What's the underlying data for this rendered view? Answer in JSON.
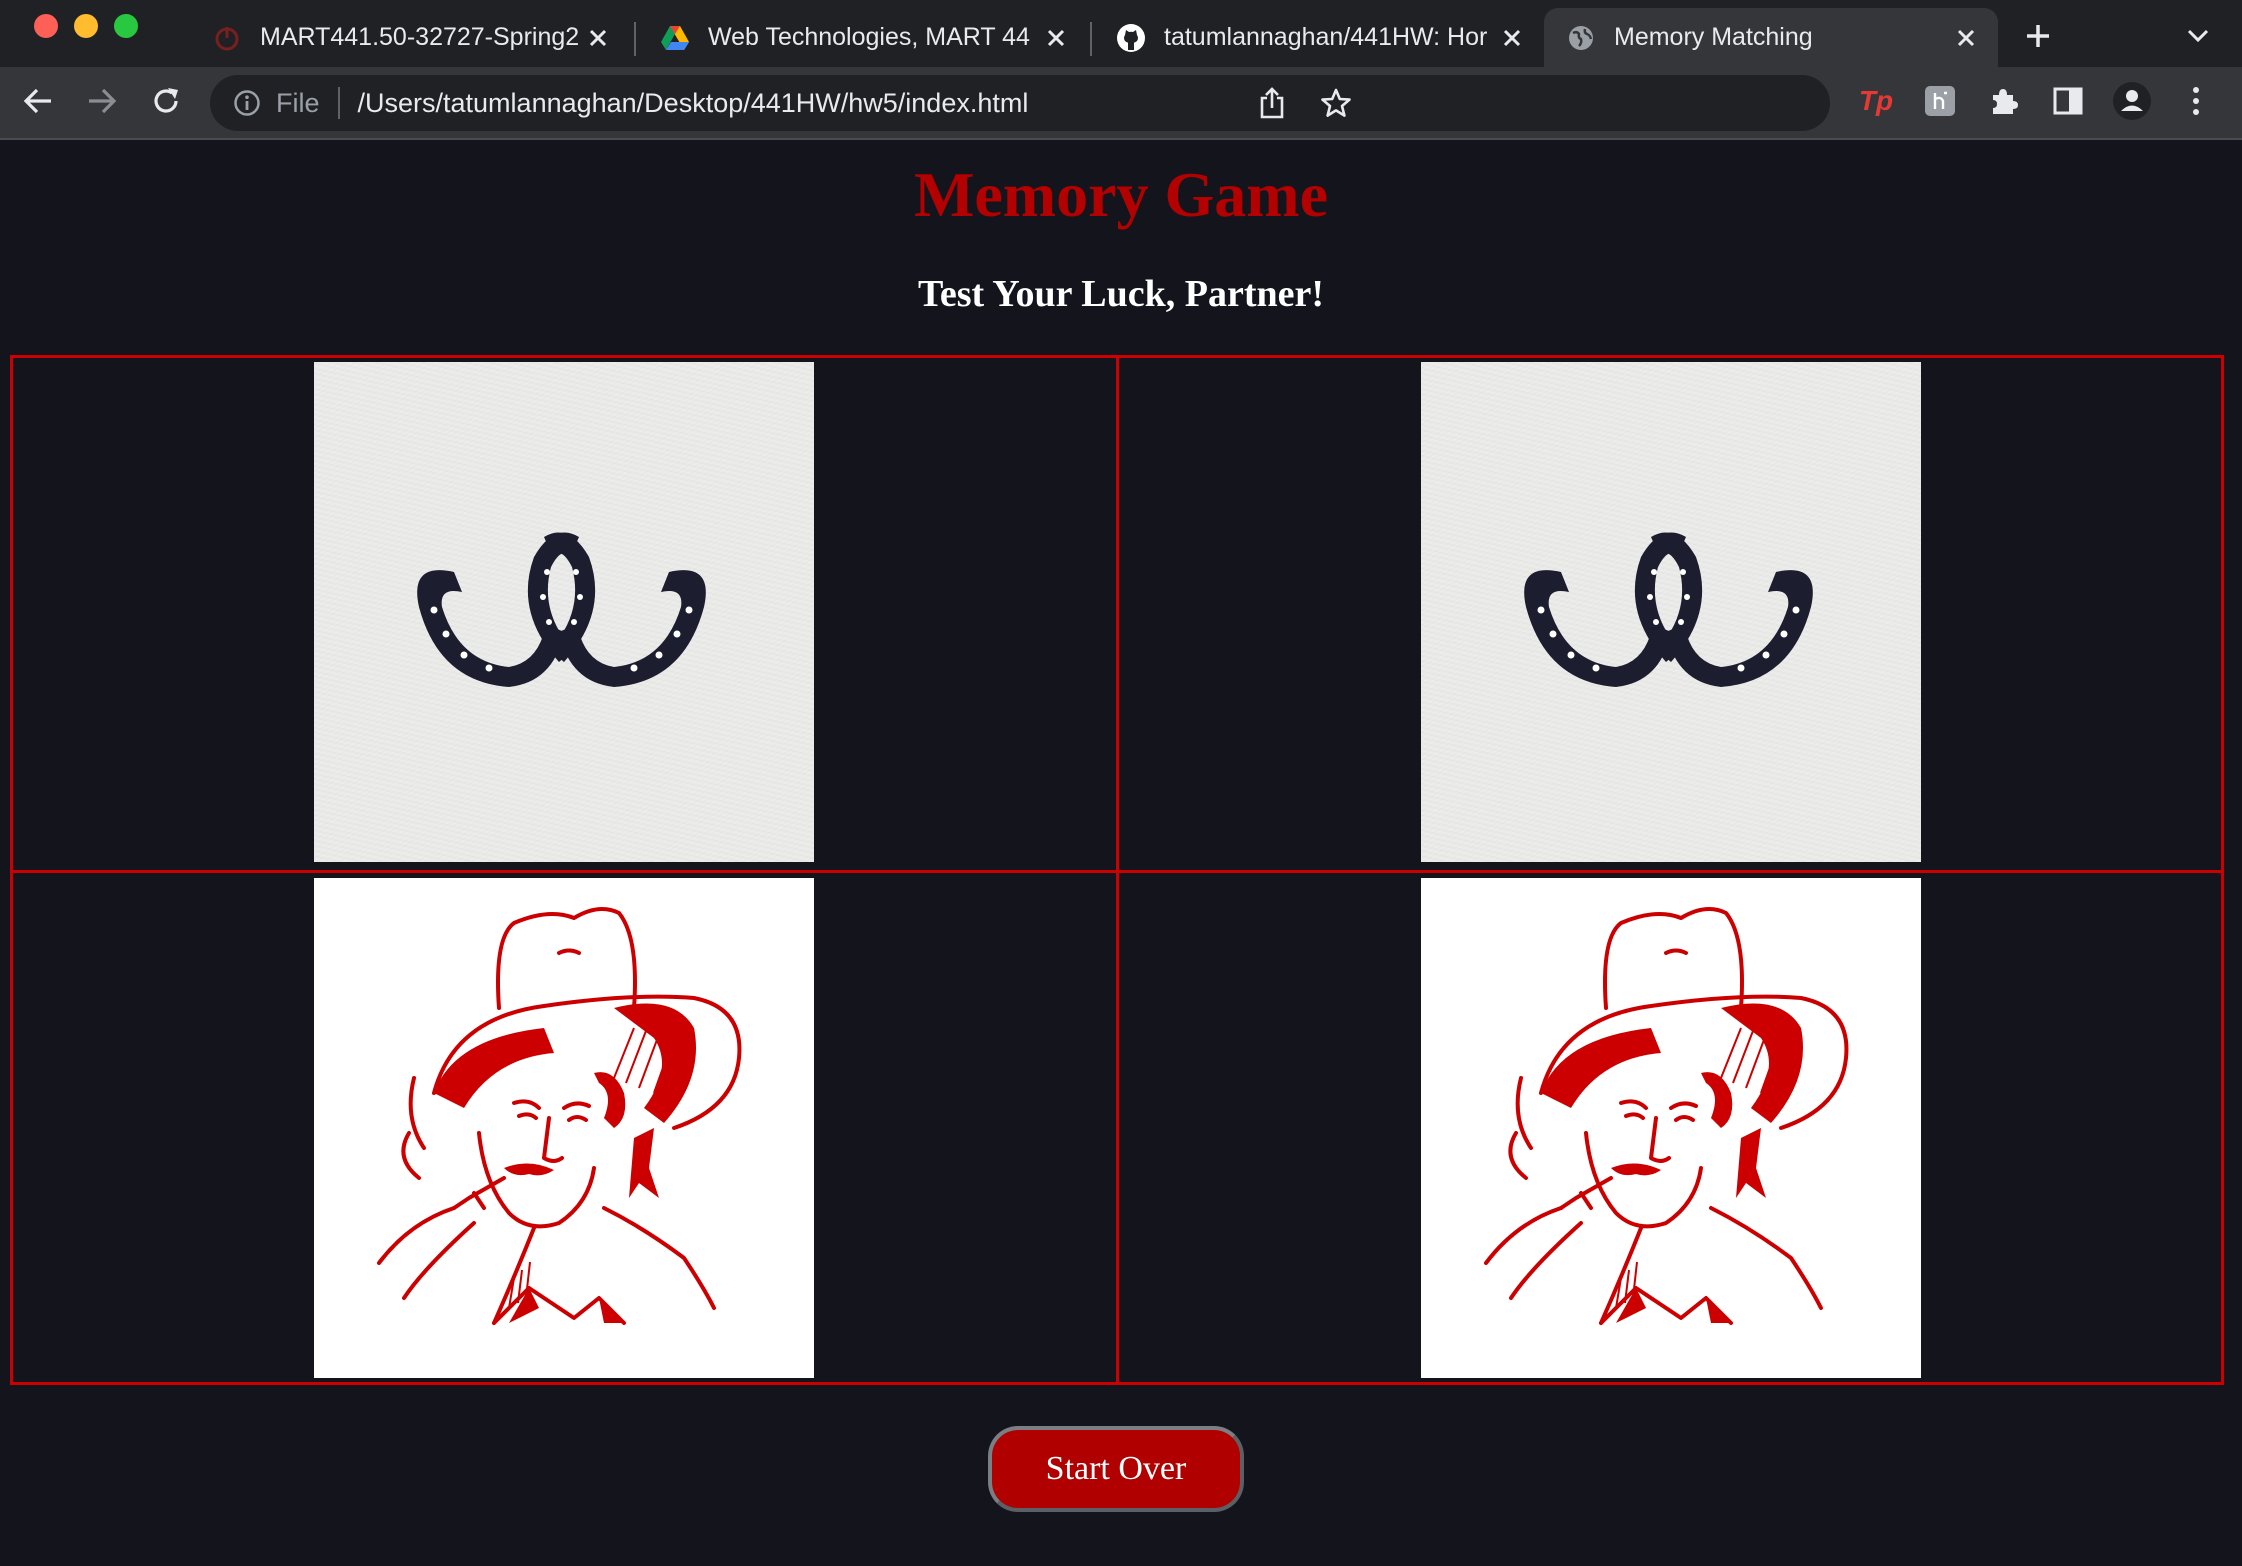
{
  "browser": {
    "tabs": [
      {
        "title": "MART441.50-32727-Spring2",
        "favicon": "power-icon",
        "active": false
      },
      {
        "title": "Web Technologies, MART 44",
        "favicon": "google-drive-icon",
        "active": false
      },
      {
        "title": "tatumlannaghan/441HW: Hor",
        "favicon": "github-icon",
        "active": false
      },
      {
        "title": "Memory Matching",
        "favicon": "globe-icon",
        "active": true
      }
    ],
    "address_bar": {
      "scheme_label": "File",
      "url": "/Users/tatumlannaghan/Desktop/441HW/hw5/index.html"
    },
    "extension_tp_label": "Tp"
  },
  "page": {
    "title": "Memory Game",
    "subtitle": "Test Your Luck, Partner!",
    "cards": [
      {
        "image": "horseshoes-icon",
        "background": "paper"
      },
      {
        "image": "horseshoes-icon",
        "background": "paper"
      },
      {
        "image": "cowboy-icon",
        "background": "white"
      },
      {
        "image": "cowboy-icon",
        "background": "white"
      }
    ],
    "start_over_label": "Start Over"
  },
  "colors": {
    "page_background": "#14151c",
    "accent_red": "#b30000",
    "grid_border": "#cc0000",
    "ink_navy": "#1c1d2e"
  }
}
